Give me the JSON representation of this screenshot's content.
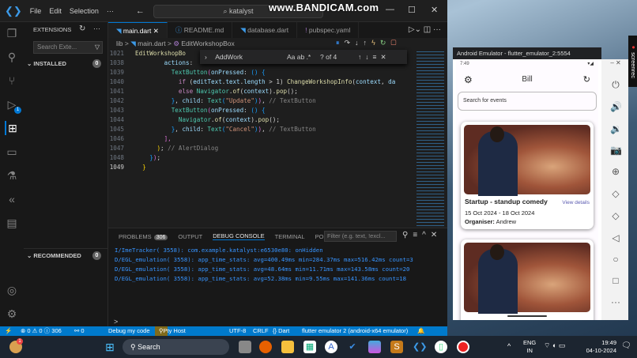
{
  "vscode": {
    "menu": [
      "File",
      "Edit",
      "Selection",
      "···"
    ],
    "command_center": "katalyst",
    "watermark": "www.BANDICAM.com",
    "sidebar": {
      "title": "EXTENSIONS",
      "search_placeholder": "Search Exte...",
      "installed": {
        "label": "INSTALLED",
        "count": "0"
      },
      "recommended": {
        "label": "RECOMMENDED",
        "count": "0"
      }
    },
    "activity_badges": {
      "run_debug": "1"
    },
    "tabs": [
      {
        "label": "main.dart",
        "active": true
      },
      {
        "label": "README.md"
      },
      {
        "label": "database.dart"
      },
      {
        "label": "pubspec.yaml"
      }
    ],
    "breadcrumb": [
      "lib",
      ">",
      "main.dart",
      ">",
      "EditWorkshopBox"
    ],
    "find": {
      "query": "AddWork",
      "result": "? of 4",
      "opts": "Aa  ab  .*"
    },
    "code": [
      {
        "n": "1021",
        "t": [
          [
            "c-fn",
            "EditWorkshopBo"
          ]
        ]
      },
      {
        "n": "1038",
        "t": [
          [
            "c-p",
            "        "
          ],
          [
            "c-var",
            "actions"
          ],
          [
            "c-p",
            ":"
          ]
        ]
      },
      {
        "n": "1039",
        "t": [
          [
            "c-p",
            "          "
          ],
          [
            "c-cls",
            "TextButton"
          ],
          [
            "c-b2",
            "("
          ],
          [
            "c-var",
            "onPressed"
          ],
          [
            "c-p",
            ": "
          ],
          [
            "c-b3",
            "() {"
          ]
        ]
      },
      {
        "n": "1040",
        "t": [
          [
            "c-p",
            "            "
          ],
          [
            "c-kw",
            "if"
          ],
          [
            "c-p",
            " ("
          ],
          [
            "c-var",
            "editText"
          ],
          [
            "c-p",
            "."
          ],
          [
            "c-var",
            "text"
          ],
          [
            "c-p",
            "."
          ],
          [
            "c-var",
            "length"
          ],
          [
            "c-p",
            " > 1) "
          ],
          [
            "c-fn",
            "ChangeWorkshopInfo"
          ],
          [
            "c-p",
            "("
          ],
          [
            "c-var",
            "context"
          ],
          [
            "c-p",
            ", "
          ],
          [
            "c-var",
            "da"
          ]
        ]
      },
      {
        "n": "1041",
        "t": [
          [
            "c-p",
            "            "
          ],
          [
            "c-kw",
            "else"
          ],
          [
            "c-p",
            " "
          ],
          [
            "c-cls",
            "Navigator"
          ],
          [
            "c-p",
            "."
          ],
          [
            "c-fn",
            "of"
          ],
          [
            "c-p",
            "("
          ],
          [
            "c-var",
            "context"
          ],
          [
            "c-p",
            ")."
          ],
          [
            "c-fn",
            "pop"
          ],
          [
            "c-p",
            "();"
          ]
        ]
      },
      {
        "n": "1042",
        "t": [
          [
            "c-p",
            "          "
          ],
          [
            "c-b3",
            "}"
          ],
          [
            "c-p",
            ", "
          ],
          [
            "c-var",
            "child"
          ],
          [
            "c-p",
            ": "
          ],
          [
            "c-cls",
            "Text"
          ],
          [
            "c-b3",
            "("
          ],
          [
            "c-str",
            "\"Update\""
          ],
          [
            "c-b3",
            ")"
          ],
          [
            "c-b2",
            ")"
          ],
          [
            "c-p",
            ", "
          ],
          [
            "c-cm2",
            "// TextButton"
          ]
        ]
      },
      {
        "n": "1043",
        "t": [
          [
            "c-p",
            "          "
          ],
          [
            "c-cls",
            "TextButton"
          ],
          [
            "c-b2",
            "("
          ],
          [
            "c-var",
            "onPressed"
          ],
          [
            "c-p",
            ": "
          ],
          [
            "c-b3",
            "() {"
          ]
        ]
      },
      {
        "n": "1044",
        "t": [
          [
            "c-p",
            "            "
          ],
          [
            "c-cls",
            "Navigator"
          ],
          [
            "c-p",
            "."
          ],
          [
            "c-fn",
            "of"
          ],
          [
            "c-p",
            "("
          ],
          [
            "c-var",
            "context"
          ],
          [
            "c-p",
            ")."
          ],
          [
            "c-fn",
            "pop"
          ],
          [
            "c-p",
            "();"
          ]
        ]
      },
      {
        "n": "1045",
        "t": [
          [
            "c-p",
            "          "
          ],
          [
            "c-b3",
            "}"
          ],
          [
            "c-p",
            ", "
          ],
          [
            "c-var",
            "child"
          ],
          [
            "c-p",
            ": "
          ],
          [
            "c-cls",
            "Text"
          ],
          [
            "c-b3",
            "("
          ],
          [
            "c-str",
            "\"Cancel\""
          ],
          [
            "c-b3",
            ")"
          ],
          [
            "c-b2",
            ")"
          ],
          [
            "c-p",
            ", "
          ],
          [
            "c-cm2",
            "// TextButton"
          ]
        ]
      },
      {
        "n": "1046",
        "t": [
          [
            "c-p",
            "        "
          ],
          [
            "c-b2",
            "],"
          ]
        ]
      },
      {
        "n": "1047",
        "t": [
          [
            "c-p",
            "      "
          ],
          [
            "c-b1",
            ")"
          ],
          [
            "c-p",
            "; "
          ],
          [
            "c-cm2",
            "// AlertDialog"
          ]
        ]
      },
      {
        "n": "1048",
        "t": [
          [
            "c-p",
            "    "
          ],
          [
            "c-b3",
            "}"
          ],
          [
            "c-b2",
            ")"
          ],
          [
            "c-p",
            ";"
          ]
        ]
      },
      {
        "n": "1049",
        "t": [
          [
            "c-p",
            "  "
          ],
          [
            "c-b1",
            "}"
          ]
        ],
        "current": true
      }
    ],
    "panel": {
      "tabs": [
        "PROBLEMS",
        "OUTPUT",
        "DEBUG CONSOLE",
        "TERMINAL",
        "PORTS"
      ],
      "problems_count": "306",
      "filter_placeholder": "Filter (e.g. text, !excl...",
      "console": [
        "I/ImeTracker( 3558): com.example.katalyst:e6530e80: onHidden",
        "D/EGL_emulation( 3558): app_time_stats: avg=400.49ms min=284.37ms max=516.42ms count=3",
        "D/EGL_emulation( 3558): app_time_stats: avg=48.64ms min=11.71ms max=143.58ms count=20",
        "D/EGL_emulation( 3558): app_time_stats: avg=52.38ms min=9.55ms max=141.36ms count=18"
      ],
      "prompt": ">"
    },
    "status": {
      "problems": "⊗ 0 ⚠ 0 ⓘ 306",
      "ports": "⚯ 0",
      "debug": "Debug my code",
      "pty": "Pty Host",
      "encoding": "UTF-8",
      "eol": "CRLF",
      "lang": "{} Dart",
      "device": "flutter emulator 2 (android-x64 emulator)"
    }
  },
  "emulator": {
    "title": "Android Emulator - flutter_emulator_2:5554",
    "time": "7:49",
    "app_title": "Bill",
    "search_placeholder": "Search for events",
    "events": [
      {
        "title": "Startup - standup comedy",
        "link": "View details",
        "dates": "15 Oct 2024 - 18 Oct 2024",
        "organiser_label": "Organiser:",
        "organiser": "Andrew"
      }
    ],
    "screenrec": "screenrec"
  },
  "taskbar": {
    "search": "Search",
    "lang": "ENG",
    "region": "IN",
    "time": "19:49",
    "date": "04-10-2024",
    "notification_badge": "1"
  }
}
